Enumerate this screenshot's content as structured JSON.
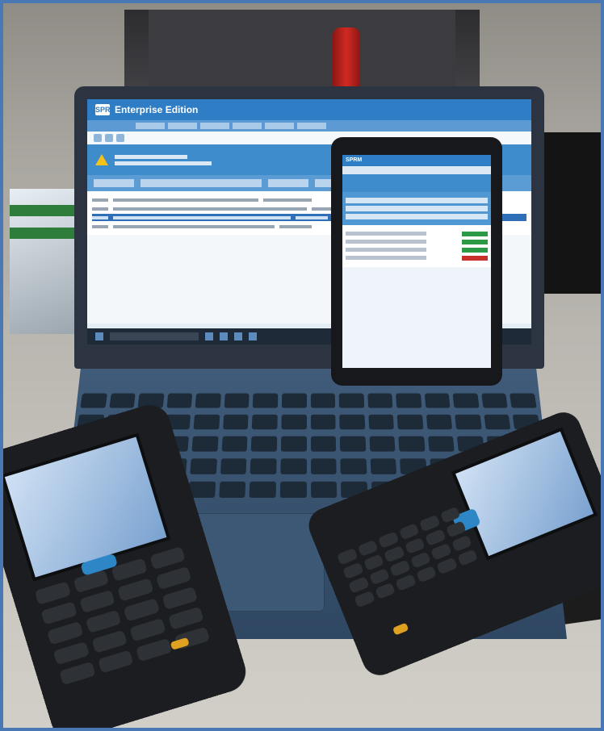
{
  "laptop": {
    "app_title": "Enterprise Edition",
    "logo_text": "SPRM"
  },
  "tablet": {
    "app_title": "SPRM"
  },
  "colors": {
    "frame_border": "#4a78b5",
    "app_accent": "#2f7dc4",
    "button_green": "#2c9a44",
    "button_red": "#c9302c",
    "scan_button": "#2d86c6",
    "function_key": "#e0a020"
  },
  "icons": [
    "warning-icon"
  ]
}
